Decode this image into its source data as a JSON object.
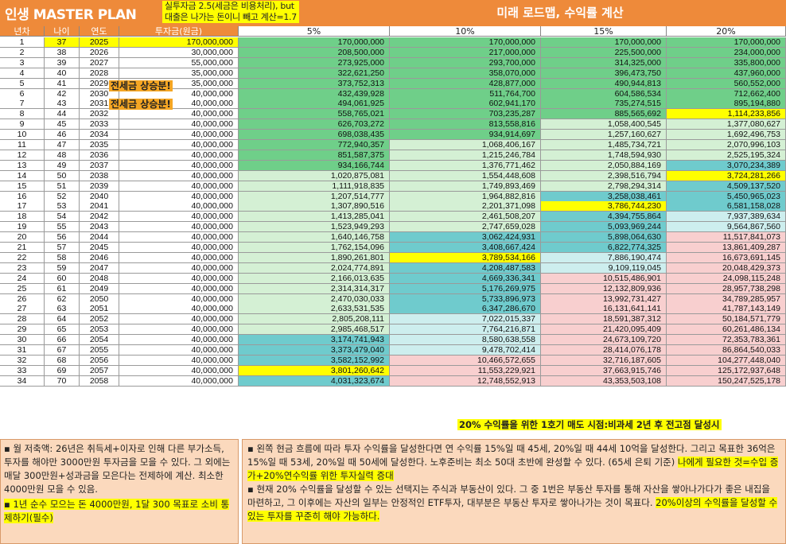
{
  "header": {
    "title": "인생 MASTER PLAN",
    "note_line1": "실투자금 2.5(세금은 비용처리), but",
    "note_line2": "대출은 나가는 돈이니 빼고 계산=1.7",
    "roadmap_title": "미래 로드맵, 수익률 계산"
  },
  "columns": [
    "년차",
    "나이",
    "연도",
    "투자금(원금)",
    "5%",
    "10%",
    "15%",
    "20%"
  ],
  "tags": {
    "tag1": "전세금 상승분!",
    "tag2": "전세금 상승분!"
  },
  "rows": [
    [
      "1",
      "37",
      "2025",
      "170,000,000",
      "170,000,000",
      "170,000,000",
      "170,000,000",
      "170,000,000"
    ],
    [
      "2",
      "38",
      "2026",
      "30,000,000",
      "208,500,000",
      "217,000,000",
      "225,500,000",
      "234,000,000"
    ],
    [
      "3",
      "39",
      "2027",
      "55,000,000",
      "273,925,000",
      "293,700,000",
      "314,325,000",
      "335,800,000"
    ],
    [
      "4",
      "40",
      "2028",
      "35,000,000",
      "322,621,250",
      "358,070,000",
      "396,473,750",
      "437,960,000"
    ],
    [
      "5",
      "41",
      "2029",
      "35,000,000",
      "373,752,313",
      "428,877,000",
      "490,944,813",
      "560,552,000"
    ],
    [
      "6",
      "42",
      "2030",
      "40,000,000",
      "432,439,928",
      "511,764,700",
      "604,586,534",
      "712,662,400"
    ],
    [
      "7",
      "43",
      "2031",
      "40,000,000",
      "494,061,925",
      "602,941,170",
      "735,274,515",
      "895,194,880"
    ],
    [
      "8",
      "44",
      "2032",
      "40,000,000",
      "558,765,021",
      "703,235,287",
      "885,565,692",
      "1,114,233,856"
    ],
    [
      "9",
      "45",
      "2033",
      "40,000,000",
      "626,703,272",
      "813,558,816",
      "1,058,400,545",
      "1,377,080,627"
    ],
    [
      "10",
      "46",
      "2034",
      "40,000,000",
      "698,038,435",
      "934,914,697",
      "1,257,160,627",
      "1,692,496,753"
    ],
    [
      "11",
      "47",
      "2035",
      "40,000,000",
      "772,940,357",
      "1,068,406,167",
      "1,485,734,721",
      "2,070,996,103"
    ],
    [
      "12",
      "48",
      "2036",
      "40,000,000",
      "851,587,375",
      "1,215,246,784",
      "1,748,594,930",
      "2,525,195,324"
    ],
    [
      "13",
      "49",
      "2037",
      "40,000,000",
      "934,166,744",
      "1,376,771,462",
      "2,050,884,169",
      "3,070,234,389"
    ],
    [
      "14",
      "50",
      "2038",
      "40,000,000",
      "1,020,875,081",
      "1,554,448,608",
      "2,398,516,794",
      "3,724,281,266"
    ],
    [
      "15",
      "51",
      "2039",
      "40,000,000",
      "1,111,918,835",
      "1,749,893,469",
      "2,798,294,314",
      "4,509,137,520"
    ],
    [
      "16",
      "52",
      "2040",
      "40,000,000",
      "1,207,514,777",
      "1,964,882,816",
      "3,258,038,461",
      "5,450,965,023"
    ],
    [
      "17",
      "53",
      "2041",
      "40,000,000",
      "1,307,890,516",
      "2,201,371,098",
      "3,786,744,230",
      "6,581,158,028"
    ],
    [
      "18",
      "54",
      "2042",
      "40,000,000",
      "1,413,285,041",
      "2,461,508,207",
      "4,394,755,864",
      "7,937,389,634"
    ],
    [
      "19",
      "55",
      "2043",
      "40,000,000",
      "1,523,949,293",
      "2,747,659,028",
      "5,093,969,244",
      "9,564,867,560"
    ],
    [
      "20",
      "56",
      "2044",
      "40,000,000",
      "1,640,146,758",
      "3,062,424,931",
      "5,898,064,630",
      "11,517,841,073"
    ],
    [
      "21",
      "57",
      "2045",
      "40,000,000",
      "1,762,154,096",
      "3,408,667,424",
      "6,822,774,325",
      "13,861,409,287"
    ],
    [
      "22",
      "58",
      "2046",
      "40,000,000",
      "1,890,261,801",
      "3,789,534,166",
      "7,886,190,474",
      "16,673,691,145"
    ],
    [
      "23",
      "59",
      "2047",
      "40,000,000",
      "2,024,774,891",
      "4,208,487,583",
      "9,109,119,045",
      "20,048,429,373"
    ],
    [
      "24",
      "60",
      "2048",
      "40,000,000",
      "2,166,013,635",
      "4,669,336,341",
      "10,515,486,901",
      "24,098,115,248"
    ],
    [
      "25",
      "61",
      "2049",
      "40,000,000",
      "2,314,314,317",
      "5,176,269,975",
      "12,132,809,936",
      "28,957,738,298"
    ],
    [
      "26",
      "62",
      "2050",
      "40,000,000",
      "2,470,030,033",
      "5,733,896,973",
      "13,992,731,427",
      "34,789,285,957"
    ],
    [
      "27",
      "63",
      "2051",
      "40,000,000",
      "2,633,531,535",
      "6,347,286,670",
      "16,131,641,141",
      "41,787,143,149"
    ],
    [
      "28",
      "64",
      "2052",
      "40,000,000",
      "2,805,208,111",
      "7,022,015,337",
      "18,591,387,312",
      "50,184,571,779"
    ],
    [
      "29",
      "65",
      "2053",
      "40,000,000",
      "2,985,468,517",
      "7,764,216,871",
      "21,420,095,409",
      "60,261,486,134"
    ],
    [
      "30",
      "66",
      "2054",
      "40,000,000",
      "3,174,741,943",
      "8,580,638,558",
      "24,673,109,720",
      "72,353,783,361"
    ],
    [
      "31",
      "67",
      "2055",
      "40,000,000",
      "3,373,479,040",
      "9,478,702,414",
      "28,414,076,178",
      "86,864,540,033"
    ],
    [
      "32",
      "68",
      "2056",
      "40,000,000",
      "3,582,152,992",
      "10,466,572,655",
      "32,716,187,605",
      "104,277,448,040"
    ],
    [
      "33",
      "69",
      "2057",
      "40,000,000",
      "3,801,260,642",
      "11,553,229,921",
      "37,663,915,746",
      "125,172,937,648"
    ],
    [
      "34",
      "70",
      "2058",
      "40,000,000",
      "4,031,323,674",
      "12,748,552,913",
      "43,353,503,108",
      "150,247,525,178"
    ]
  ],
  "banner": "20% 수익률을 위한 1호기 매도 시점:비과세 2년 후 전고점 달성시",
  "left_notes": {
    "p1": "▪ 월 저축액: 26년은 취득세+이자로 인해 다른 부가소득, 투자를 해야만 3000만원 투자금을 모을 수 있다. 그 외에는 매달 300만원+성과금을 모은다는 전제하에 계산. 최소한 4000만원 모을 수 있음.",
    "p2": "▪ 1년 순수 모으는 돈 4000만원, 1달 300 목표로 소비 통제하기(필수)"
  },
  "right_notes": {
    "p1a": "▪ 왼쪽 현금 흐름에 따라 투자 수익률을 달성한다면 연 수익률 15%일 때 45세, 20%일 때 44세 10억을 달성한다. 그리고 목표한 36억은 15%일 때 53세, 20%일 때 50세에 달성한다. 노후준비는 최소 50대 초반에 완성할 수 있다. (65세 은퇴 기준) ",
    "p1b": "나에게 필요한 것=수입 증가+20%연수익률 위한 투자실력 증대",
    "p2a": "▪ 현재 20% 수익률을 달성할 수 있는 선택지는 주식과 부동산이 있다. 그 중 1번은 부동산 투자를 통해 자산을 쌓아나가다가 좋은 내집을 마련하고, 그 이후에는 자산의 일부는 안정적인 ETF투자, 대부분은 부동산 투자로 쌓아나가는 것이 목표다. ",
    "p2b": "20%이상의 수익률을 달성할 수 있는 투자를 꾸준히 해야 가능하다."
  },
  "colors": {
    "header": "#ee8a3a",
    "highlight": "#ffff00",
    "green_dark": "#6fcf89",
    "green_light": "#d4f0d4",
    "teal_dark": "#6fcbcd",
    "teal_light": "#cdeeee",
    "pink": "#f8cfcf",
    "note_box": "#fbd9bd"
  }
}
